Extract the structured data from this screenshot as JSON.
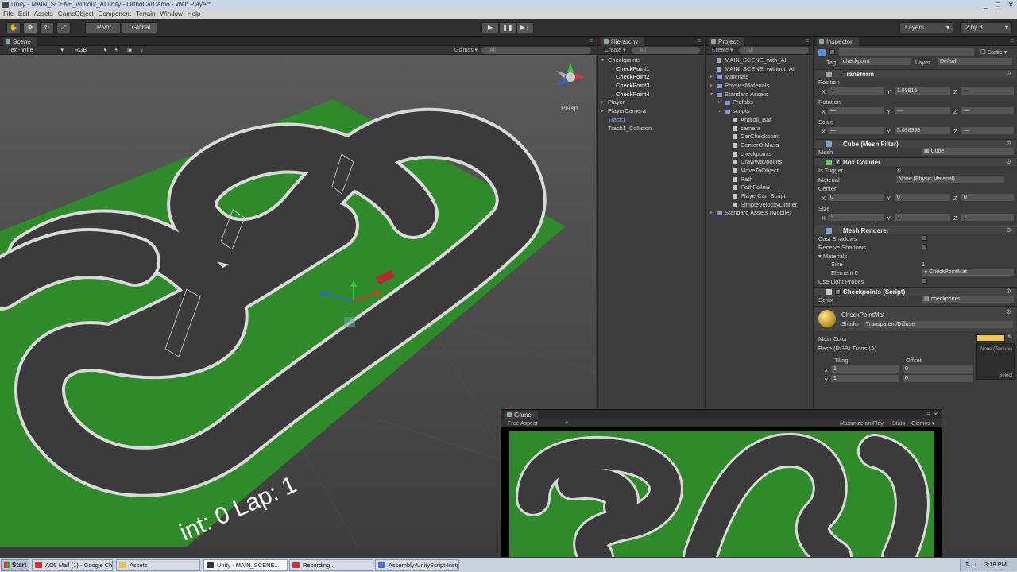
{
  "window": {
    "title": "Unity - MAIN_SCENE_without_AI.unity - OrthoCarDemo - Web Player*",
    "controls": [
      "_",
      "□",
      "✕"
    ]
  },
  "menu": [
    "File",
    "Edit",
    "Assets",
    "GameObject",
    "Component",
    "Terrain",
    "Window",
    "Help"
  ],
  "toolbar": {
    "pivot_label": "Pivot",
    "global_label": "Global",
    "layers_label": "Layers",
    "layout_label": "2 by 3"
  },
  "scene": {
    "tab_label": "Scene",
    "render_mode": "Tex - Wire",
    "color_mode": "RGB",
    "gizmos_label": "Gizmos",
    "search_placeholder": "All",
    "persp_label": "Persp",
    "hud_text": "int: 0 Lap: 1"
  },
  "hierarchy": {
    "tab_label": "Hierarchy",
    "create_label": "Create",
    "search_placeholder": "All",
    "items": [
      {
        "label": "Checkpoints",
        "indent": 0,
        "fold": "▾",
        "style": ""
      },
      {
        "label": "CheckPoint1",
        "indent": 1,
        "fold": "",
        "style": "sel"
      },
      {
        "label": "CheckPoint2",
        "indent": 1,
        "fold": "",
        "style": "sel"
      },
      {
        "label": "CheckPoint3",
        "indent": 1,
        "fold": "",
        "style": "sel"
      },
      {
        "label": "CheckPoint4",
        "indent": 1,
        "fold": "",
        "style": "sel"
      },
      {
        "label": "Player",
        "indent": 0,
        "fold": "▸",
        "style": ""
      },
      {
        "label": "PlayerCamera",
        "indent": 0,
        "fold": "▸",
        "style": ""
      },
      {
        "label": "Track1",
        "indent": 0,
        "fold": "",
        "style": "blue"
      },
      {
        "label": "Track1_Collision",
        "indent": 0,
        "fold": "",
        "style": ""
      }
    ]
  },
  "project": {
    "tab_label": "Project",
    "create_label": "Create",
    "search_placeholder": "All",
    "items": [
      {
        "label": "MAIN_SCENE_with_AI",
        "indent": 0,
        "type": "scene",
        "fold": ""
      },
      {
        "label": "MAIN_SCENE_without_AI",
        "indent": 0,
        "type": "scene",
        "fold": ""
      },
      {
        "label": "Materials",
        "indent": 0,
        "type": "folder",
        "fold": "▸"
      },
      {
        "label": "PhysicsMaterials",
        "indent": 0,
        "type": "folder",
        "fold": "▸"
      },
      {
        "label": "Standard Assets",
        "indent": 0,
        "type": "folder",
        "fold": "▾"
      },
      {
        "label": "Prefabs",
        "indent": 1,
        "type": "folder",
        "fold": "▸"
      },
      {
        "label": "scripts",
        "indent": 1,
        "type": "folder",
        "fold": "▾"
      },
      {
        "label": "Antiroll_Bar",
        "indent": 2,
        "type": "file",
        "fold": ""
      },
      {
        "label": "camera",
        "indent": 2,
        "type": "file",
        "fold": ""
      },
      {
        "label": "CarCheckpoint",
        "indent": 2,
        "type": "file",
        "fold": ""
      },
      {
        "label": "CenterOfMass",
        "indent": 2,
        "type": "file",
        "fold": ""
      },
      {
        "label": "checkpoints",
        "indent": 2,
        "type": "file",
        "fold": ""
      },
      {
        "label": "DrawWaypoints",
        "indent": 2,
        "type": "file",
        "fold": ""
      },
      {
        "label": "MoveToObject",
        "indent": 2,
        "type": "file",
        "fold": ""
      },
      {
        "label": "Path",
        "indent": 2,
        "type": "file",
        "fold": ""
      },
      {
        "label": "PathFollow",
        "indent": 2,
        "type": "file",
        "fold": ""
      },
      {
        "label": "PlayerCar_Script",
        "indent": 2,
        "type": "file",
        "fold": ""
      },
      {
        "label": "SimpleVelocityLimiter",
        "indent": 2,
        "type": "file",
        "fold": ""
      },
      {
        "label": "Standard Assets (Mobile)",
        "indent": 0,
        "type": "folder",
        "fold": "▸"
      }
    ]
  },
  "inspector": {
    "tab_label": "Inspector",
    "static_label": "Static",
    "tag_label": "Tag",
    "tag_value": "checkpoint",
    "layer_label": "Layer",
    "layer_value": "Default",
    "transform": {
      "title": "Transform",
      "position_label": "Position",
      "rotation_label": "Rotation",
      "scale_label": "Scale",
      "x_label": "X",
      "y_label": "Y",
      "z_label": "Z",
      "position_y": "1.69915",
      "scale_y": "3.698998",
      "dash": "—"
    },
    "mesh_filter": {
      "title": "Cube (Mesh Filter)",
      "mesh_label": "Mesh",
      "mesh_value": "Cube"
    },
    "box_collider": {
      "title": "Box Collider",
      "is_trigger_label": "Is Trigger",
      "material_label": "Material",
      "material_value": "None (Physic Material)",
      "center_label": "Center",
      "center_x": "0",
      "center_y": "0",
      "center_z": "0",
      "size_label": "Size",
      "size_x": "1",
      "size_y": "1",
      "size_z": "1"
    },
    "mesh_renderer": {
      "title": "Mesh Renderer",
      "cast_shadows_label": "Cast Shadows",
      "receive_shadows_label": "Receive Shadows",
      "materials_label": "Materials",
      "size_label": "Size",
      "size_value": "1",
      "element0_label": "Element 0",
      "element0_value": "CheckPointMat",
      "light_probes_label": "Use Light Probes"
    },
    "checkpoints_script": {
      "title": "Checkpoints (Script)",
      "script_label": "Script",
      "script_value": "checkpoints"
    },
    "material": {
      "name": "CheckPointMat",
      "shader_label": "Shader",
      "shader_value": "Transparent/Diffuse",
      "main_color_label": "Main Color",
      "base_label": "Base (RGB) Trans (A)",
      "tiling_label": "Tiling",
      "offset_label": "Offset",
      "x_label": "x",
      "y_label": "y",
      "tiling_x": "1",
      "tiling_y": "1",
      "offset_x": "0",
      "offset_y": "0",
      "texture_label": "None (Texture)",
      "select_label": "Select",
      "main_color": "#f2c84a"
    }
  },
  "game": {
    "tab_label": "Game",
    "aspect_label": "Free Aspect",
    "maximize_label": "Maximize on Play",
    "stats_label": "Stats",
    "gizmos_label": "Gizmos"
  },
  "taskbar": {
    "start_label": "Start",
    "tasks": [
      {
        "label": "AOL Mail (1) - Google Chr...",
        "color": "#d33"
      },
      {
        "label": "Assets",
        "color": "#e8c34a"
      },
      {
        "label": "Unity - MAIN_SCENE...",
        "color": "#333"
      },
      {
        "label": "Recording...",
        "color": "#c33"
      },
      {
        "label": "Assembly-UnityScript-Instp...",
        "color": "#4a6fd0"
      }
    ],
    "clock": "3:18 PM"
  },
  "colors": {
    "grass": "#2f8a2a",
    "asphalt": "#3b3b3b",
    "curb": "#d9d9d9",
    "selection_blue": "#3d6fb8"
  }
}
